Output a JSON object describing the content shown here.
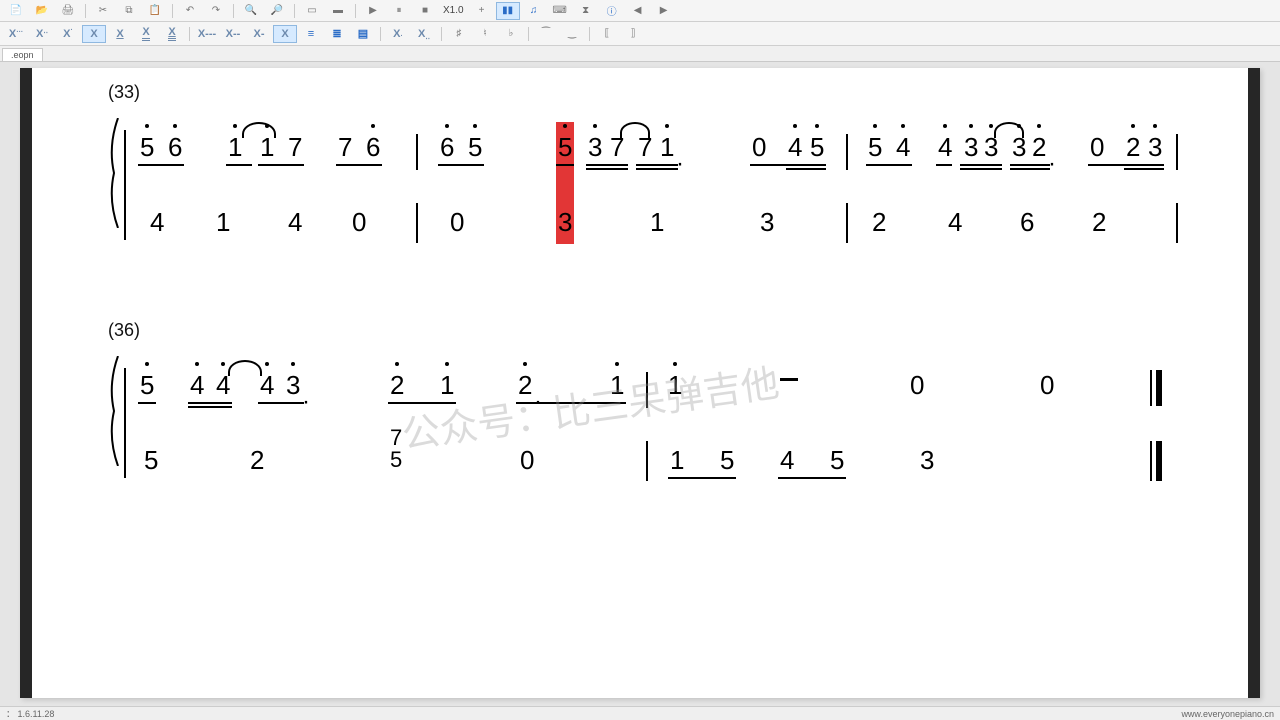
{
  "app": {
    "title": "EveryonePiano Numbered Notation Editor"
  },
  "toolbar1": {
    "buttons": [
      "new",
      "open",
      "print",
      "sep",
      "cut",
      "copy",
      "paste",
      "sep",
      "undo",
      "redo",
      "sep",
      "zoom-out",
      "zoom-in",
      "sep",
      "fit-page",
      "fit-width"
    ],
    "zoom_label": "X1.0",
    "right_buttons": [
      "play",
      "pause",
      "stop",
      "toggle-jianpu",
      "toggle-staff",
      "metronome",
      "midi",
      "settings"
    ]
  },
  "toolbar2": {
    "duration_buttons": [
      {
        "glyph": "X",
        "deco": "···"
      },
      {
        "glyph": "X",
        "deco": "··"
      },
      {
        "glyph": "X",
        "deco": "·"
      },
      {
        "glyph": "X",
        "deco": "",
        "active": true
      },
      {
        "glyph": "X",
        "deco": "_"
      },
      {
        "glyph": "X",
        "deco": "__"
      },
      {
        "glyph": "X",
        "deco": "___"
      }
    ],
    "dotted_buttons": [
      "X---",
      "X--",
      "X-",
      "X",
      "X·",
      "X··"
    ],
    "accidental_buttons": [
      "whole-rest",
      "half-rest",
      "sharp",
      "natural",
      "flat",
      "tie",
      "slur",
      "repeat-start",
      "repeat-end"
    ]
  },
  "tabs": {
    "active": ".eopn"
  },
  "score": {
    "systems": [
      {
        "bar_number": "(33)",
        "upper": [
          {
            "group": [
              "5̇",
              "6̇"
            ],
            "ul": 1
          },
          {
            "group": [
              "1̇",
              "1̇",
              "7",
              "7",
              "6̇"
            ],
            "tie": [
              1,
              2
            ],
            "ul": 1
          },
          {
            "bar": true
          },
          {
            "group": [
              "6̇",
              "5̇"
            ],
            "ul": 1
          },
          {
            "highlight": true,
            "group": [
              "5̇"
            ]
          },
          {
            "group": [
              "3̇",
              "7",
              "7",
              "1̇·"
            ],
            "tie": [
              2,
              3
            ],
            "ul": 2
          },
          {
            "group": [
              "0",
              "4̇",
              "5̇"
            ],
            "ul": 2
          },
          {
            "bar": true
          },
          {
            "group": [
              "5̇",
              "4̇"
            ],
            "ul": 1
          },
          {
            "group": [
              "4̇",
              "3̇",
              "3̇",
              "3̇",
              "2̇·"
            ],
            "tie": [
              3,
              4
            ],
            "ul": 2
          },
          {
            "group": [
              "0",
              "2̇",
              "3̇"
            ],
            "ul": 2
          },
          {
            "bar": true
          }
        ],
        "lower": [
          "4",
          "1",
          "4",
          "0",
          "|",
          "0",
          "3(h)",
          "1",
          "3",
          "|",
          "2",
          "4",
          "6",
          "2",
          "|"
        ]
      },
      {
        "bar_number": "(36)",
        "upper": [
          {
            "group": [
              "5̇",
              "4̇",
              "4̇",
              "4̇",
              "3̇·"
            ],
            "tie": [
              2,
              3
            ],
            "ul": 2
          },
          {
            "group": [
              "2̇",
              "1̇"
            ],
            "ul": 1
          },
          {
            "group": [
              "2̇·",
              "1̇"
            ],
            "ul": 1
          },
          {
            "bar": true
          },
          {
            "group": [
              "1̇"
            ]
          },
          {
            "dash": true
          },
          {
            "group": [
              "0"
            ]
          },
          {
            "group": [
              "0"
            ]
          },
          {
            "dblbar": true
          }
        ],
        "lower": [
          "5",
          "2",
          "(7/5)",
          "0",
          "|",
          "1 5",
          "4 5",
          "3",
          "‖"
        ]
      }
    ],
    "watermark": "公众号：比三呆弹吉他"
  },
  "status": {
    "left": "： 1.6.11.28",
    "right": "www.everyonepiano.cn"
  }
}
